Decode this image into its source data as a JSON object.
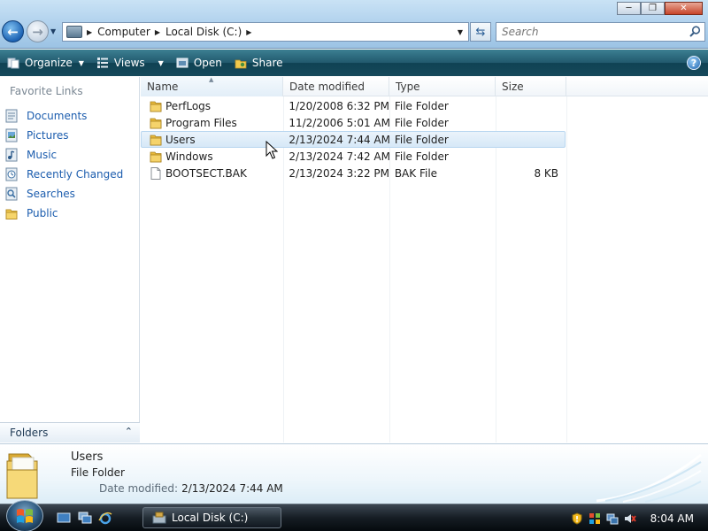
{
  "window": {
    "address": {
      "crumbs": [
        "Computer",
        "Local Disk (C:)"
      ]
    },
    "search": {
      "placeholder": "Search"
    }
  },
  "toolbar": {
    "organize_label": "Organize",
    "views_label": "Views",
    "open_label": "Open",
    "share_label": "Share"
  },
  "nav": {
    "favorites_header": "Favorite Links",
    "links": [
      {
        "label": "Documents",
        "icon": "documents-icon"
      },
      {
        "label": "Pictures",
        "icon": "pictures-icon"
      },
      {
        "label": "Music",
        "icon": "music-icon"
      },
      {
        "label": "Recently Changed",
        "icon": "recently-changed-icon"
      },
      {
        "label": "Searches",
        "icon": "searches-icon"
      },
      {
        "label": "Public",
        "icon": "public-folder-icon"
      }
    ],
    "folders_label": "Folders"
  },
  "files": {
    "columns": [
      "Name",
      "Date modified",
      "Type",
      "Size"
    ],
    "rows": [
      {
        "name": "PerfLogs",
        "date": "1/20/2008 6:32 PM",
        "type": "File Folder",
        "size": "",
        "icon": "folder-icon"
      },
      {
        "name": "Program Files",
        "date": "11/2/2006 5:01 AM",
        "type": "File Folder",
        "size": "",
        "icon": "folder-icon"
      },
      {
        "name": "Users",
        "date": "2/13/2024 7:44 AM",
        "type": "File Folder",
        "size": "",
        "icon": "folder-icon"
      },
      {
        "name": "Windows",
        "date": "2/13/2024 7:42 AM",
        "type": "File Folder",
        "size": "",
        "icon": "folder-icon"
      },
      {
        "name": "BOOTSECT.BAK",
        "date": "2/13/2024 3:22 PM",
        "type": "BAK File",
        "size": "8 KB",
        "icon": "file-icon"
      }
    ],
    "selected_index": 2
  },
  "details": {
    "name": "Users",
    "type": "File Folder",
    "date_label": "Date modified:",
    "date_value": "2/13/2024 7:44 AM"
  },
  "taskbar": {
    "task_label": "Local Disk (C:)",
    "clock": "8:04 AM"
  },
  "colors": {
    "toolbar": "#1b5366",
    "link": "#1c5dae",
    "selection": "#d6e8f7"
  }
}
